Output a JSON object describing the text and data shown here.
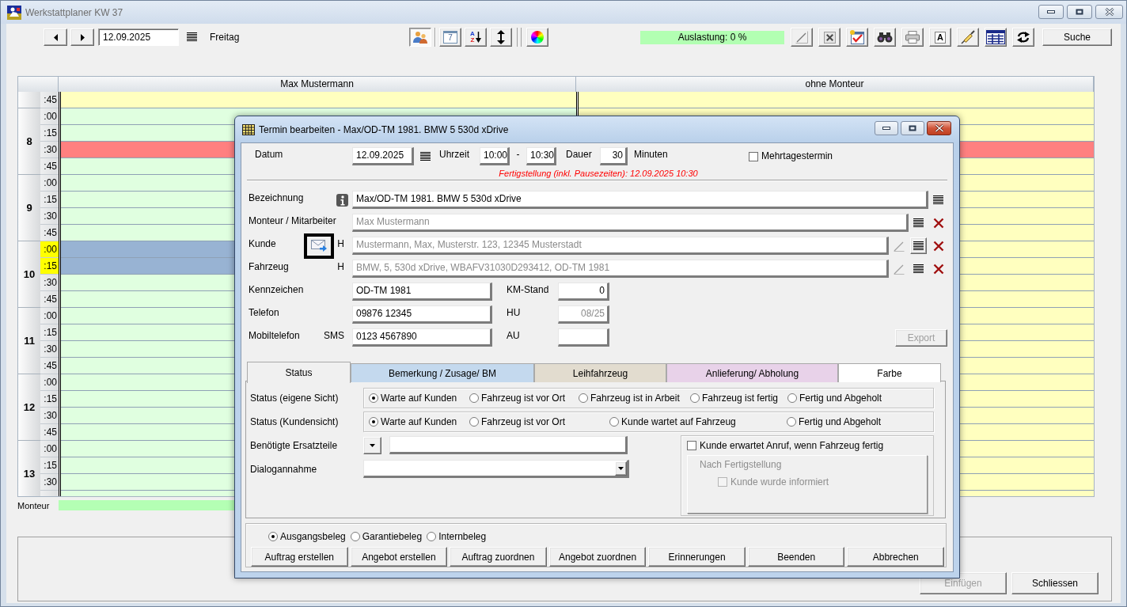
{
  "window": {
    "title": "Werkstattplaner KW 37"
  },
  "toolbar": {
    "date": "12.09.2025",
    "weekday": "Freitag",
    "view_tools": [
      {
        "kind": "people",
        "pressed": true
      },
      {
        "kind": "calendar",
        "glyph": "7",
        "pressed": false
      },
      {
        "kind": "sort",
        "glyphs": [
          "A",
          "Z"
        ],
        "pressed": false
      },
      {
        "kind": "row-height",
        "pressed": false
      },
      {
        "kind": "colors",
        "pressed": false
      }
    ],
    "load": "Auslastung: 0 %",
    "tools": [
      {
        "kind": "edit"
      },
      {
        "kind": "delete"
      },
      {
        "kind": "checklist"
      },
      {
        "kind": "binoculars"
      },
      {
        "kind": "print"
      },
      {
        "kind": "font",
        "glyph": "A"
      },
      {
        "kind": "syringe"
      },
      {
        "kind": "table"
      },
      {
        "kind": "refresh"
      }
    ],
    "search_button": "Suche"
  },
  "schedule": {
    "columns": [
      "Max Mustermann",
      "ohne Monteur"
    ],
    "hours": [
      {
        "slots": [
          {
            "minute": ":45",
            "highlighted": false,
            "cells": [
              {
                "color": "#ffffbf"
              },
              {
                "color": "#ffffbf"
              }
            ]
          }
        ]
      },
      {
        "hour": "8",
        "slots": [
          {
            "minute": ":00",
            "highlighted": false,
            "cells": [
              {
                "color": "#e0ffe0"
              },
              {
                "color": "#ffffbf"
              }
            ]
          },
          {
            "minute": ":15",
            "highlighted": false,
            "cells": [
              {
                "color": "#e0ffe0"
              },
              {
                "color": "#ffffbf"
              }
            ]
          },
          {
            "minute": ":30",
            "highlighted": false,
            "cells": [
              {
                "color": "#ff8080"
              },
              {
                "color": "#ff8080"
              }
            ]
          },
          {
            "minute": ":45",
            "highlighted": false,
            "cells": [
              {
                "color": "#e0ffe0"
              },
              {
                "color": "#ffffbf"
              }
            ]
          }
        ]
      },
      {
        "hour": "9",
        "slots": [
          {
            "minute": ":00",
            "highlighted": false,
            "cells": [
              {
                "color": "#e0ffe0"
              },
              {
                "color": "#ffffbf"
              }
            ]
          },
          {
            "minute": ":15",
            "highlighted": false,
            "cells": [
              {
                "color": "#e0ffe0"
              },
              {
                "color": "#ffffbf"
              }
            ]
          },
          {
            "minute": ":30",
            "highlighted": false,
            "cells": [
              {
                "color": "#e0ffe0"
              },
              {
                "color": "#ffffbf"
              }
            ]
          },
          {
            "minute": ":45",
            "highlighted": false,
            "cells": [
              {
                "color": "#e0ffe0"
              },
              {
                "color": "#ffffbf"
              }
            ]
          }
        ]
      },
      {
        "hour": "10",
        "slots": [
          {
            "minute": ":00",
            "highlighted": true,
            "cells": [
              {
                "color": "#98b3d3"
              },
              {
                "color": "#ffffbf"
              }
            ]
          },
          {
            "minute": ":15",
            "highlighted": true,
            "cells": [
              {
                "color": "#98b3d3"
              },
              {
                "color": "#ffffbf"
              }
            ]
          },
          {
            "minute": ":30",
            "highlighted": false,
            "cells": [
              {
                "color": "#e0ffe0"
              },
              {
                "color": "#ffffbf"
              }
            ]
          },
          {
            "minute": ":45",
            "highlighted": false,
            "cells": [
              {
                "color": "#e0ffe0"
              },
              {
                "color": "#ffffbf"
              }
            ]
          }
        ]
      },
      {
        "hour": "11",
        "slots": [
          {
            "minute": ":00",
            "highlighted": false,
            "cells": [
              {
                "color": "#e0ffe0"
              },
              {
                "color": "#ffffbf"
              }
            ]
          },
          {
            "minute": ":15",
            "highlighted": false,
            "cells": [
              {
                "color": "#e0ffe0"
              },
              {
                "color": "#ffffbf"
              }
            ]
          },
          {
            "minute": ":30",
            "highlighted": false,
            "cells": [
              {
                "color": "#e0ffe0"
              },
              {
                "color": "#ffffbf"
              }
            ]
          },
          {
            "minute": ":45",
            "highlighted": false,
            "cells": [
              {
                "color": "#e0ffe0"
              },
              {
                "color": "#ffffbf"
              }
            ]
          }
        ]
      },
      {
        "hour": "12",
        "slots": [
          {
            "minute": ":00",
            "highlighted": false,
            "cells": [
              {
                "color": "#e0ffe0"
              },
              {
                "color": "#ffffbf"
              }
            ]
          },
          {
            "minute": ":15",
            "highlighted": false,
            "cells": [
              {
                "color": "#e0ffe0"
              },
              {
                "color": "#ffffbf"
              }
            ]
          },
          {
            "minute": ":30",
            "highlighted": false,
            "cells": [
              {
                "color": "#e0ffe0"
              },
              {
                "color": "#ffffbf"
              }
            ]
          },
          {
            "minute": ":45",
            "highlighted": false,
            "cells": [
              {
                "color": "#e0ffe0"
              },
              {
                "color": "#ffffbf"
              }
            ]
          }
        ]
      },
      {
        "hour": "13",
        "slots": [
          {
            "minute": ":00",
            "highlighted": false,
            "cells": [
              {
                "color": "#e0ffe0"
              },
              {
                "color": "#ffffbf"
              }
            ]
          },
          {
            "minute": ":15",
            "highlighted": false,
            "cells": [
              {
                "color": "#e0ffe0"
              },
              {
                "color": "#ffffbf"
              }
            ]
          },
          {
            "minute": ":30",
            "highlighted": false,
            "cells": [
              {
                "color": "#e0ffe0"
              },
              {
                "color": "#ffffbf"
              }
            ]
          },
          {
            "highlighted": false,
            "cells": [
              {
                "color": "#e0ffe0"
              },
              {
                "color": "#ffffbf"
              }
            ]
          }
        ]
      }
    ],
    "footer_label": "Monteur"
  },
  "bottom_buttons": [
    {
      "label": "Einfügen",
      "disabled": true
    },
    {
      "label": "Schliessen",
      "disabled": false
    }
  ],
  "dialog": {
    "title": "Termin bearbeiten - Max/OD-TM 1981. BMW 5 530d xDrive",
    "schedule_row": {
      "date_label": "Datum",
      "date": "12.09.2025",
      "time_label": "Uhrzeit",
      "start": "10:00",
      "separator": "-",
      "end": "10:30",
      "duration_label": "Dauer",
      "duration": "30",
      "unit": "Minuten",
      "multiday": {
        "label": "Mehrtagestermin",
        "checked": false
      }
    },
    "completion_note": "Fertigstellung (inkl. Pausezeiten): 12.09.2025 10:30",
    "links": [
      {
        "kind": "info",
        "label": "Bezeichnung",
        "value": "Max/OD-TM 1981. BMW 5 530d xDrive",
        "readonly": false,
        "actions": [
          {
            "kind": "list",
            "raised": false
          }
        ]
      },
      {
        "kind": "plain",
        "label": "Monteur / Mitarbeiter",
        "value": "Max Mustermann",
        "readonly": true,
        "actions": [
          {
            "kind": "list",
            "raised": false
          },
          {
            "kind": "delete"
          }
        ]
      },
      {
        "kind": "mail",
        "label": "Kunde",
        "focused": true,
        "tag": "H",
        "value": "Mustermann, Max, Musterstr. 123, 12345 Musterstadt",
        "readonly": true,
        "actions": [
          {
            "kind": "edit"
          },
          {
            "kind": "list",
            "raised": true
          },
          {
            "kind": "delete"
          }
        ]
      },
      {
        "kind": "plain",
        "label": "Fahrzeug",
        "tag": "H",
        "value": "BMW, 5, 530d xDrive, WBAFV31030D293412, OD-TM 1981",
        "readonly": true,
        "actions": [
          {
            "kind": "edit"
          },
          {
            "kind": "list",
            "raised": false
          },
          {
            "kind": "delete"
          }
        ]
      }
    ],
    "details": [
      {
        "label": "Kennzeichen",
        "value": "OD-TM 1981",
        "side_label": "KM-Stand",
        "side_value": "0",
        "side_readonly": false
      },
      {
        "label": "Telefon",
        "value": "09876 12345",
        "side_label": "HU",
        "side_value": "08/25",
        "side_readonly": true
      },
      {
        "label": "Mobiltelefon",
        "tag": "SMS",
        "value": "0123 4567890",
        "side_label": "AU"
      }
    ],
    "export_button": {
      "label": "Export",
      "disabled": true
    },
    "tabs": [
      {
        "label": "Status",
        "selected": true,
        "color": "#f0f0f0"
      },
      {
        "label": "Bemerkung / Zusage/ BM",
        "selected": false,
        "color": "#c4d9ee"
      },
      {
        "label": "Leihfahrzeug",
        "selected": false,
        "color": "#e2dccf"
      },
      {
        "label": "Anlieferung/ Abholung",
        "selected": false,
        "color": "#e8d2e9"
      },
      {
        "label": "Farbe",
        "selected": false,
        "color": "#ffffff"
      }
    ],
    "status_groups": [
      {
        "label": "Status (eigene Sicht)",
        "options": [
          {
            "label": "Warte auf Kunden",
            "selected": true
          },
          {
            "label": "Fahrzeug ist vor Ort",
            "selected": false
          },
          {
            "label": "Fahrzeug ist in Arbeit",
            "selected": false
          },
          {
            "label": "Fahrzeug ist fertig",
            "selected": false
          },
          {
            "label": "Fertig und Abgeholt",
            "selected": false
          }
        ]
      },
      {
        "label": "Status (Kundensicht)",
        "options": [
          {
            "label": "Warte auf Kunden",
            "selected": true
          },
          {
            "label": "Fahrzeug ist vor Ort",
            "selected": false
          },
          {
            "label": "Kunde wartet auf Fahrzeug",
            "selected": false
          },
          {
            "label": "Fertig und Abgeholt",
            "selected": false
          }
        ]
      }
    ],
    "parts": {
      "label": "Benötigte Ersatzteile"
    },
    "intake": {
      "label": "Dialogannahme"
    },
    "callback": {
      "label": "Kunde erwartet Anruf, wenn Fahrzeug fertig",
      "checked": false,
      "after": {
        "title": "Nach Fertigstellung",
        "label": "Kunde wurde informiert",
        "checked": false,
        "disabled": true
      }
    },
    "document_types": [
      {
        "label": "Ausgangsbeleg",
        "selected": true
      },
      {
        "label": "Garantiebeleg",
        "selected": false
      },
      {
        "label": "Internbeleg",
        "selected": false
      }
    ],
    "actions": [
      "Auftrag erstellen",
      "Angebot erstellen",
      "Auftrag zuordnen",
      "Angebot zuordnen",
      "Erinnerungen",
      "Beenden",
      "Abbrechen"
    ]
  }
}
